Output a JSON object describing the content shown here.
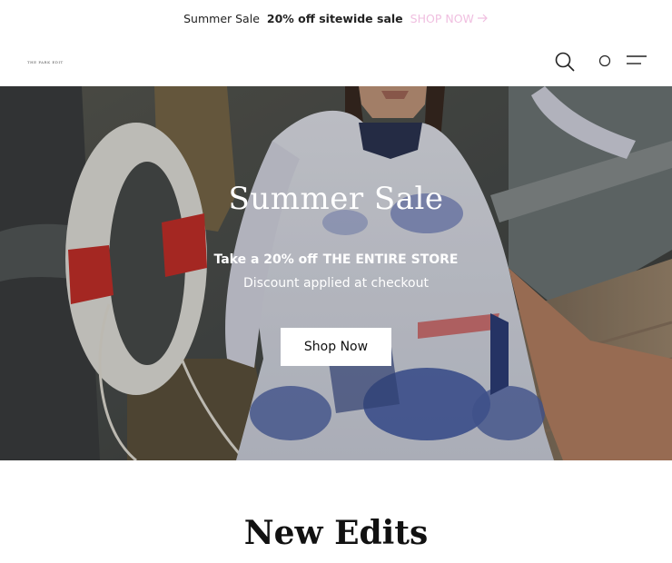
{
  "announcement": {
    "sale_label": "Summer Sale",
    "offer_label": "20% off sitewide sale",
    "shop_link_label": "SHOP NOW",
    "shop_link_color": "#f0bfe0",
    "arrow_icon": "arrow-right-icon"
  },
  "header": {
    "logo_text": "THE PARK EDIT",
    "icons": [
      "search-icon",
      "account-icon",
      "menu-icon"
    ]
  },
  "hero": {
    "title": "Summer Sale",
    "line1_prefix": "Take a 20% off",
    "line1_emphasis": "THE ENTIRE STORE",
    "line2": "Discount applied at checkout",
    "cta_label": "Shop Now"
  },
  "section": {
    "title": "New Edits"
  }
}
